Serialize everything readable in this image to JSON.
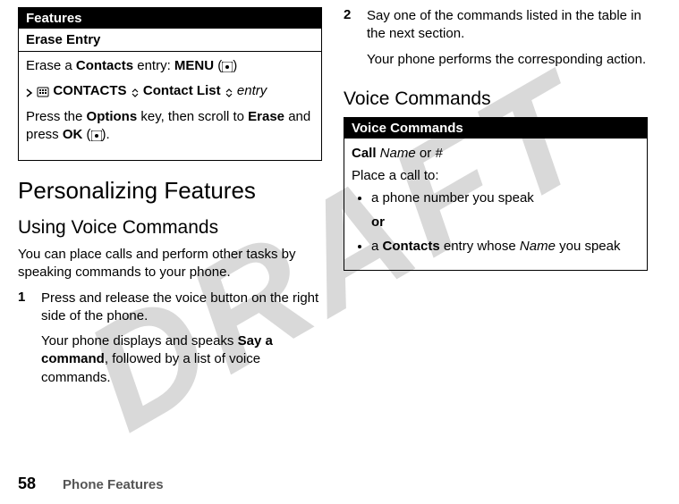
{
  "watermark": "DRAFT",
  "features_table": {
    "header": "Features",
    "sub": "Erase Entry",
    "line1_a": "Erase a ",
    "line1_b": "Contacts",
    "line1_c": " entry: ",
    "line1_d": "MENU",
    "seq_a": "CONTACTS",
    "seq_b": "Contact List",
    "seq_c": "entry",
    "line2_a": "Press the ",
    "line2_b": "Options",
    "line2_c": " key, then scroll to ",
    "line2_d": "Erase",
    "line2_e": " and press ",
    "line2_f": "OK"
  },
  "h1": "Personalizing Features",
  "h2": "Using Voice Commands",
  "intro": "You can place calls and perform other tasks by speaking commands to your phone.",
  "step1": {
    "num": "1",
    "p1": "Press and release the voice button on the right side of the phone.",
    "p2a": "Your phone displays and speaks ",
    "p2b": "Say a command",
    "p2c": ", followed by a list of voice commands."
  },
  "step2": {
    "num": "2",
    "p1": "Say one of the commands listed in the table in the next section.",
    "p2": "Your phone performs the corresponding action."
  },
  "vc_heading": "Voice Commands",
  "vc_table": {
    "header": "Voice Commands",
    "row1_a": "Call",
    "row1_b": " Name ",
    "row1_c": "or",
    "row1_d": " #",
    "place": "Place a call to:",
    "b1": "a phone number you speak",
    "or": "or",
    "b2_a": "a ",
    "b2_b": "Contacts",
    "b2_c": " entry whose ",
    "b2_d": "Name",
    "b2_e": " you speak"
  },
  "footer": {
    "page": "58",
    "text": "Phone Features"
  }
}
